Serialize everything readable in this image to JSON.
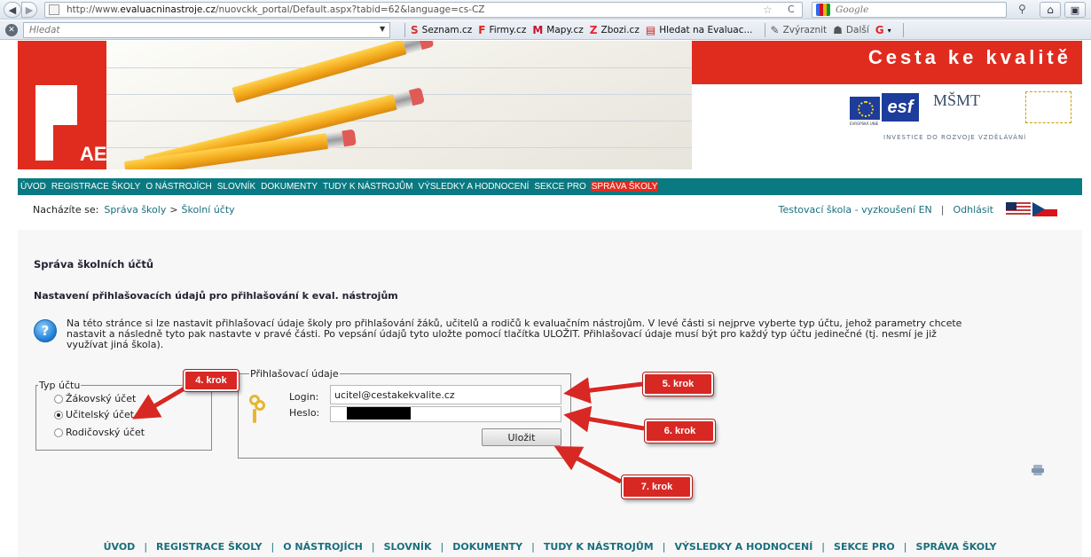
{
  "browser": {
    "url_prefix": "http://www.",
    "url_domain": "evaluacninastroje.cz",
    "url_path": "/nuovckk_portal/Default.aspx?tabid=62&language=cs-CZ",
    "search_engine_placeholder": "Google",
    "toolbar_search_placeholder": "Hledat",
    "toolbar_links": [
      {
        "icon": "S",
        "icon_color": "#d9302a",
        "label": "Seznam.cz"
      },
      {
        "icon": "F",
        "icon_color": "#e2231a",
        "label": "Firmy.cz"
      },
      {
        "icon": "M",
        "icon_color": "#c8102e",
        "label": "Mapy.cz"
      },
      {
        "icon": "Z",
        "icon_color": "#e8232a",
        "label": "Zbozi.cz"
      },
      {
        "icon": "▤",
        "icon_color": "#c22",
        "label": "Hledat na Evaluac..."
      }
    ],
    "toolbar_tools": [
      {
        "icon": "✎",
        "label": "Zvýraznit"
      },
      {
        "icon": "☗",
        "label": "Další"
      }
    ]
  },
  "header": {
    "logo_text": "AE",
    "slogan": "Cesta ke kvalitě",
    "esf_text": "esf",
    "msmt_text": "MŠMT",
    "eu_caption": "EVROPSKÁ UNIE",
    "investice": "INVESTICE DO ROZVOJE VZDĚLÁVÁNÍ"
  },
  "menu": [
    {
      "label": "ÚVOD",
      "active": false
    },
    {
      "label": "REGISTRACE ŠKOLY",
      "active": false
    },
    {
      "label": "O NÁSTROJÍCH",
      "active": false
    },
    {
      "label": "SLOVNÍK",
      "active": false
    },
    {
      "label": "DOKUMENTY",
      "active": false
    },
    {
      "label": "TUDY K NÁSTROJŮM",
      "active": false
    },
    {
      "label": "VÝSLEDKY A HODNOCENÍ",
      "active": false
    },
    {
      "label": "SEKCE PRO",
      "active": false
    },
    {
      "label": "SPRÁVA ŠKOLY",
      "active": true
    }
  ],
  "breadcrumb": {
    "label": "Nacházíte se:",
    "items": [
      "Správa školy",
      "Školní účty"
    ],
    "separator": ">"
  },
  "user": {
    "school": "Testovací škola - vyzkoušení EN",
    "logout": "Odhlásit"
  },
  "content": {
    "title": "Správa školních účtů",
    "subtitle": "Nastavení přihlašovacích údajů pro přihlašování k eval. nástrojům",
    "info": "Na této stránce si lze nastavit přihlašovací údaje školy pro přihlašování žáků, učitelů a rodičů k evaluačním nástrojům. V levé části si nejprve vyberte typ účtu, jehož parametry chcete nastavit a následně tyto pak nastavte v pravé části. Po vepsání údajů tyto uložte pomocí tlačítka ULOŽIT. Přihlašovací údaje musí být pro každý typ účtu jedinečné (tj. nesmí je již využívat jiná škola).",
    "account_type": {
      "legend": "Typ účtu",
      "options": [
        {
          "label": "Žákovský účet",
          "selected": false
        },
        {
          "label": "Učitelský účet",
          "selected": true
        },
        {
          "label": "Rodičovský účet",
          "selected": false
        }
      ]
    },
    "login": {
      "legend": "Přihlašovací údaje",
      "login_label": "Login:",
      "login_value": "ucitel@cestakekvalite.cz",
      "password_label": "Heslo:",
      "save_label": "Uložit"
    }
  },
  "annotations": {
    "step4": "4. krok",
    "step5": "5. krok",
    "step6": "6. krok",
    "step7": "7. krok"
  },
  "footer": [
    "ÚVOD",
    "REGISTRACE ŠKOLY",
    "O NÁSTROJÍCH",
    "SLOVNÍK",
    "DOKUMENTY",
    "TUDY K NÁSTROJŮM",
    "VÝSLEDKY A HODNOCENÍ",
    "SEKCE PRO",
    "SPRÁVA ŠKOLY"
  ],
  "colors": {
    "brand_red": "#e02c1f",
    "menu_teal": "#0a7a82",
    "link_teal": "#1a6f7d",
    "annotation_red": "#d82824"
  }
}
